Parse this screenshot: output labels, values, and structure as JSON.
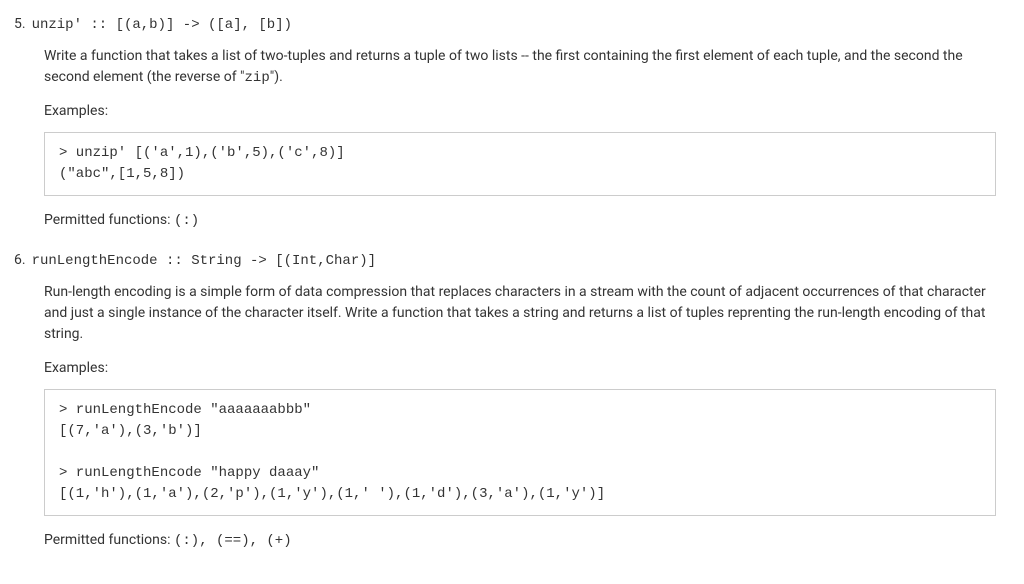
{
  "items": [
    {
      "number": "5.",
      "signature": "unzip' :: [(a,b)] -> ([a], [b])",
      "description_prefix": "Write a function that takes a list of two-tuples and returns a tuple of two lists -- the first containing the first element of each tuple, and the second the second element (the reverse of \"",
      "description_code": "zip",
      "description_suffix": "\").",
      "examples_label": "Examples:",
      "code": "> unzip' [('a',1),('b',5),('c',8)]\n(\"abc\",[1,5,8])",
      "permitted_label": "Permitted functions: ",
      "permitted_code": "(:)"
    },
    {
      "number": "6.",
      "signature": "runLengthEncode :: String -> [(Int,Char)]",
      "description_prefix": "Run-length encoding is a simple form of data compression that replaces characters in a stream with the count of adjacent occurrences of that character and just a single instance of the character itself. Write a function that takes a string and returns a list of tuples reprenting the run-length encoding of that string.",
      "description_code": "",
      "description_suffix": "",
      "examples_label": "Examples:",
      "code": "> runLengthEncode \"aaaaaaabbb\"\n[(7,'a'),(3,'b')]\n\n> runLengthEncode \"happy daaay\"\n[(1,'h'),(1,'a'),(2,'p'),(1,'y'),(1,' '),(1,'d'),(3,'a'),(1,'y')]",
      "permitted_label": "Permitted functions: ",
      "permitted_code": "(:), (==), (+)"
    }
  ]
}
